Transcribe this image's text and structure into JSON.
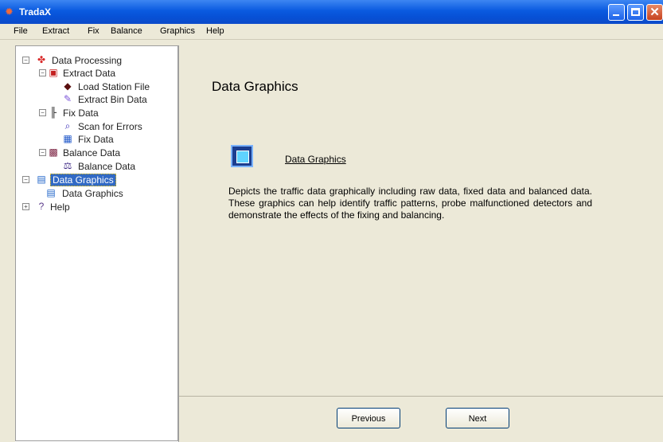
{
  "window": {
    "title": "TradaX",
    "accent_color": "#0a5ae0"
  },
  "menu": [
    "File",
    "Extract",
    "Fix",
    "Balance",
    "Graphics",
    "Help"
  ],
  "tree": {
    "data_processing": "Data Processing",
    "extract_data": "Extract Data",
    "load_station_file": "Load Station File",
    "extract_bin_data": "Extract Bin Data",
    "fix_data": "Fix Data",
    "scan_for_errors": "Scan for Errors",
    "fix_data_item": "Fix Data",
    "balance_data": "Balance Data",
    "balance_data_item": "Balance Data",
    "data_graphics": "Data Graphics",
    "data_graphics_item": "Data Graphics",
    "help": "Help"
  },
  "main": {
    "title": "Data Graphics",
    "link_label": "Data Graphics",
    "description": "Depicts the traffic data graphically including raw data, fixed data and balanced data. These graphics can help identify traffic patterns, probe malfunctioned detectors and demonstrate the effects of the fixing and balancing."
  },
  "buttons": {
    "previous": "Previous",
    "next": "Next"
  }
}
